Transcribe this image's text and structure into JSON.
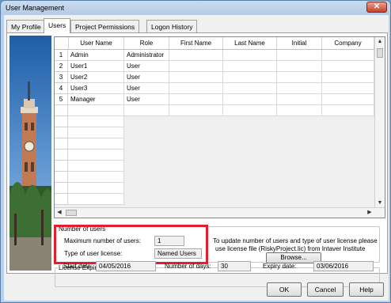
{
  "window": {
    "title": "User Management",
    "close_label": "✕"
  },
  "tabs": [
    "My Profile",
    "Users",
    "Project Permissions",
    "Logon History"
  ],
  "grid": {
    "columns": [
      "User Name",
      "Role",
      "First Name",
      "Last Name",
      "Initial",
      "Company"
    ],
    "rows": [
      {
        "num": "1",
        "user": "Admin",
        "role": "Administrator"
      },
      {
        "num": "2",
        "user": "User1",
        "role": "User"
      },
      {
        "num": "3",
        "user": "User2",
        "role": "User"
      },
      {
        "num": "4",
        "user": "User3",
        "role": "User"
      },
      {
        "num": "5",
        "user": "Manager",
        "role": "User"
      }
    ]
  },
  "number_of_users": {
    "title": "Number of users",
    "max_label": "Maximum number of users:",
    "max_value": "1",
    "type_label": "Type of user license:",
    "type_value": "Named Users",
    "info_line1": "To update number of users and type of user license please",
    "info_line2": "use license file (RiskyProject.lic) from Intaver Institute",
    "browse_label": "Browse..."
  },
  "license_expiry": {
    "title": "License Expiry Date",
    "start_label": "Start date:",
    "start_value": "04/05/2016",
    "days_label": "Number of days:",
    "days_value": "30",
    "expiry_label": "Expiry date:",
    "expiry_value": "03/06/2016"
  },
  "buttons": {
    "ok": "OK",
    "cancel": "Cancel",
    "help": "Help"
  },
  "colors": {
    "highlight": "#e0202c"
  }
}
